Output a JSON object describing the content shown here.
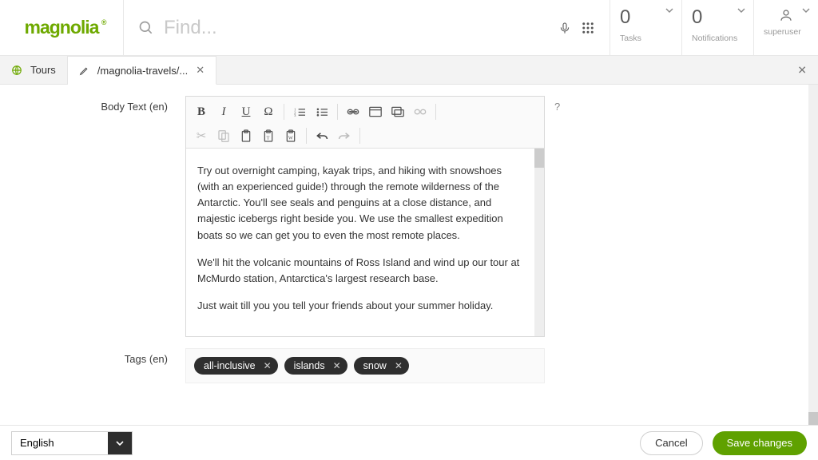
{
  "header": {
    "brand": "magnolia",
    "search_placeholder": "Find...",
    "tasks": {
      "value": "0",
      "label": "Tasks"
    },
    "notifications": {
      "value": "0",
      "label": "Notifications"
    },
    "user": {
      "label": "superuser"
    }
  },
  "tabs": {
    "primary_label": "Tours",
    "editing_label": "/magnolia-travels/..."
  },
  "form": {
    "bodytext_label": "Body Text (en)",
    "help_marker": "?",
    "tags_label": "Tags (en)",
    "paragraphs": [
      "Try out overnight camping, kayak trips, and hiking with snowshoes (with an experienced guide!) through the remote wilderness of the Antarctic. You'll see seals and penguins at a close distance, and majestic icebergs right beside you. We use the smallest expedition boats so we can get you to even the most remote places.",
      "We'll hit the volcanic mountains of Ross Island and wind up our tour at McMurdo station, Antarctica's largest research base.",
      "Just wait till you you tell your friends about your summer holiday."
    ],
    "tags": [
      "all-inclusive",
      "islands",
      "snow"
    ]
  },
  "footer": {
    "language": "English",
    "cancel": "Cancel",
    "save": "Save changes"
  }
}
